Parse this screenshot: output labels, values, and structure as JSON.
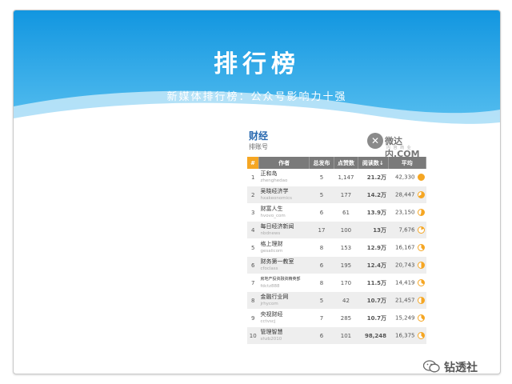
{
  "slide": {
    "title": "排行榜",
    "subtitle": "新媒体排行榜：公众号影响力十强",
    "colors": {
      "banner_top": "#1aa0e8",
      "banner_bottom": "#62c6f2"
    }
  },
  "ranking": {
    "category": "财经",
    "subcategory": "排账号",
    "logo": {
      "text": "微达内.COM",
      "tagline": "内 容 商 业"
    },
    "columns": [
      "#",
      "作者",
      "总发布",
      "点赞数",
      "阅读数↓",
      "平均"
    ],
    "rows": [
      {
        "rank": "1",
        "name": "正和岛",
        "account": "zhenghedao",
        "posts": "5",
        "likes": "1,147",
        "reads": "21.2万",
        "avg": "42,330",
        "fill": 1.0
      },
      {
        "rank": "2",
        "name": "吴晓经济学",
        "account": "hxakeonomics",
        "posts": "5",
        "likes": "177",
        "reads": "14.2万",
        "avg": "28,447",
        "fill": 0.67
      },
      {
        "rank": "3",
        "name": "财富人生",
        "account": "hvovo_com",
        "posts": "6",
        "likes": "61",
        "reads": "13.9万",
        "avg": "23,150",
        "fill": 0.55
      },
      {
        "rank": "4",
        "name": "每日经济新闻",
        "account": "nbdnews",
        "posts": "17",
        "likes": "100",
        "reads": "13万",
        "avg": "7,676",
        "fill": 0.18
      },
      {
        "rank": "5",
        "name": "格上理财",
        "account": "gesalicom",
        "posts": "8",
        "likes": "153",
        "reads": "12.9万",
        "avg": "16,167",
        "fill": 0.38
      },
      {
        "rank": "6",
        "name": "财务第一教室",
        "account": "cfoclass",
        "posts": "6",
        "likes": "195",
        "reads": "12.4万",
        "avg": "20,743",
        "fill": 0.49
      },
      {
        "rank": "7",
        "name": "房地产投资融资精英部",
        "account": "fdctz888",
        "posts": "8",
        "likes": "170",
        "reads": "11.5万",
        "avg": "14,419",
        "fill": 0.34,
        "small": true
      },
      {
        "rank": "8",
        "name": "金融行业网",
        "account": "jrhycom",
        "posts": "5",
        "likes": "42",
        "reads": "10.7万",
        "avg": "21,457",
        "fill": 0.51
      },
      {
        "rank": "9",
        "name": "央视财经",
        "account": "cctvscj",
        "posts": "7",
        "likes": "285",
        "reads": "10.7万",
        "avg": "15,249",
        "fill": 0.36
      },
      {
        "rank": "10",
        "name": "管理智慧",
        "account": "shzb2010",
        "posts": "6",
        "likes": "101",
        "reads": "98,248",
        "avg": "16,375",
        "fill": 0.39
      }
    ],
    "colors": {
      "accent": "#f5a623",
      "header": "#7a7a7a",
      "title": "#2a6ab0"
    }
  },
  "footer": {
    "text": "钻透社",
    "icon": "wechat-icon"
  }
}
